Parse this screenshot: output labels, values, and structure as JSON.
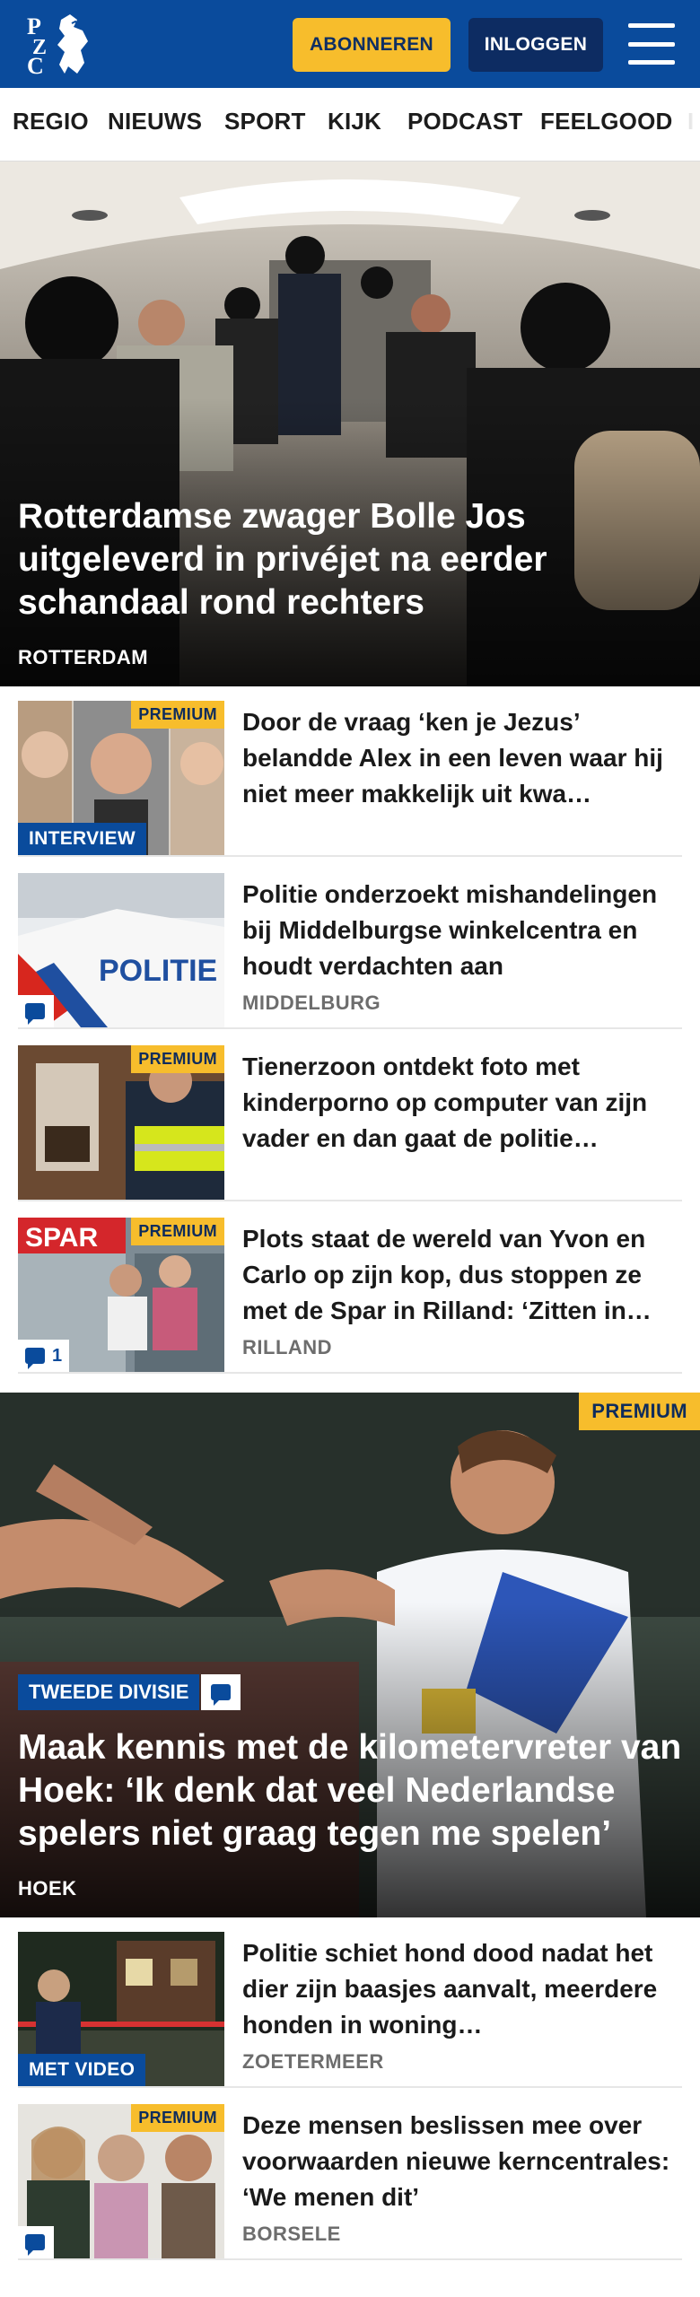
{
  "header": {
    "logo_alt": "PZC",
    "subscribe_label": "ABONNEREN",
    "login_label": "INLOGGEN",
    "brand_color": "#0a4b9c",
    "accent_color": "#f7bd2c"
  },
  "nav": {
    "items": [
      {
        "label": "REGIO"
      },
      {
        "label": "NIEUWS"
      },
      {
        "label": "SPORT"
      },
      {
        "label": "KIJK"
      },
      {
        "label": "PODCAST"
      },
      {
        "label": "FEELGOOD"
      },
      {
        "label": "I"
      }
    ]
  },
  "hero": {
    "title": "Rotterdamse zwager Bolle Jos uitgeleverd in privéjet na eerder schandaal rond rechters",
    "location": "ROTTERDAM"
  },
  "articles": [
    {
      "title": "Door de vraag ‘ken je Jezus’ belandde Alex in een leven waar hij niet meer makkelijk uit kwa…",
      "premium": "PREMIUM",
      "label": "INTERVIEW"
    },
    {
      "title": "Politie onderzoekt mishandelin­gen bij Middelburgse winkelcen­tra en houdt verdachten aan",
      "location": "MIDDELBURG",
      "comments": ""
    },
    {
      "title": "Tienerzoon ontdekt foto met kinderporno op computer van zijn vader en dan gaat de politie…",
      "premium": "PREMIUM"
    },
    {
      "title": "Plots staat de wereld van Yvon en Carlo op zijn kop, dus stoppen ze met de Spar in Rilland: ‘Zitten in…",
      "location": "RILLAND",
      "premium": "PREMIUM",
      "comments": "1"
    }
  ],
  "hero2": {
    "premium": "PREMIUM",
    "section": "TWEEDE DIVISIE",
    "title": "Maak kennis met de kilometervreter van Hoek: ‘Ik denk dat veel Nederland­se spelers niet graag tegen me spelen’",
    "location": "HOEK"
  },
  "articles2": [
    {
      "title": "Politie schiet hond dood nadat het dier zijn baasjes aanvalt, meerdere honden in woning…",
      "location": "ZOETERMEER",
      "label": "MET VIDEO"
    },
    {
      "title": "Deze mensen beslissen mee over voorwaarden nieuwe kerncentra­les: ‘We menen dit’",
      "location": "BORSELE",
      "premium": "PREMIUM",
      "comments": ""
    }
  ]
}
